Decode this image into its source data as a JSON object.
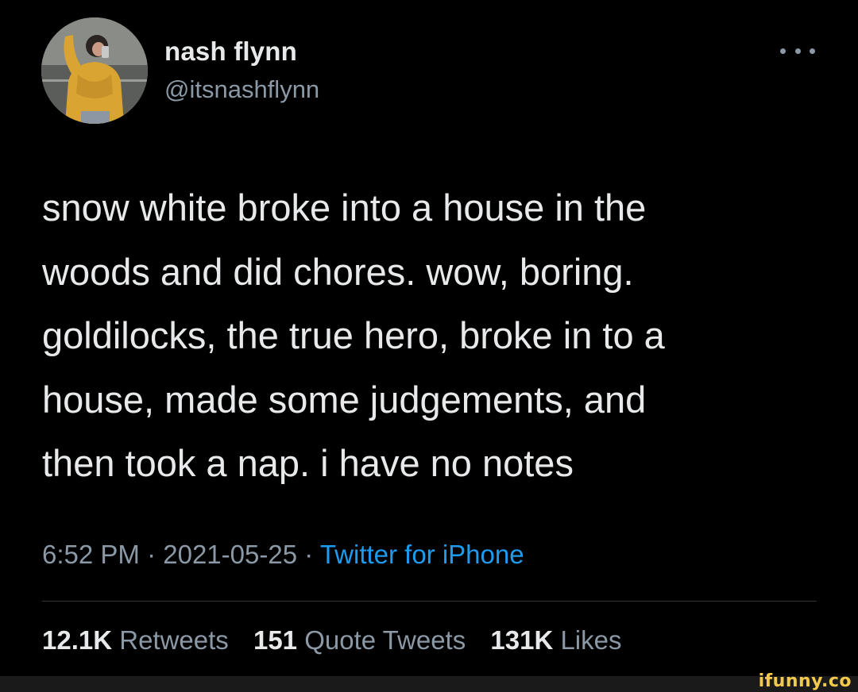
{
  "author": {
    "display_name": "nash flynn",
    "handle": "@itsnashflynn",
    "avatar_icon": "profile-photo"
  },
  "tweet": {
    "lines": [
      "snow white broke into a house in the",
      "woods and did chores. wow, boring.",
      "goldilocks, the true hero, broke in to a",
      "house, made some judgements, and",
      "then took a nap. i have no notes"
    ]
  },
  "meta": {
    "time": "6:52 PM",
    "separator": "·",
    "date": "2021-05-25",
    "source": "Twitter for iPhone"
  },
  "stats": {
    "retweets_count": "12.1K",
    "retweets_label": "Retweets",
    "quotes_count": "151",
    "quotes_label": "Quote Tweets",
    "likes_count": "131K",
    "likes_label": "Likes"
  },
  "watermark": "ifunny.co",
  "colors": {
    "background": "#000000",
    "primary_text": "#e7e9ea",
    "secondary_text": "#8b98a5",
    "link": "#1d9bf0",
    "watermark": "#f2c94c"
  }
}
